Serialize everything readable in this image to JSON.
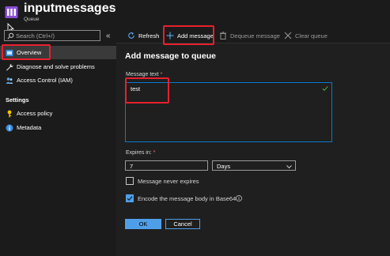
{
  "header": {
    "title": "inputmessages",
    "subtitle": "Queue",
    "more": "···"
  },
  "search": {
    "placeholder": "Search (Ctrl+/)",
    "value": ""
  },
  "collapse_glyph": "«",
  "sidebar": {
    "items": [
      {
        "label": "Overview",
        "icon": "overview-icon",
        "active": true
      },
      {
        "label": "Diagnose and solve problems",
        "icon": "wrench-icon"
      },
      {
        "label": "Access Control (IAM)",
        "icon": "people-icon"
      }
    ],
    "settings_label": "Settings",
    "settings_items": [
      {
        "label": "Access policy",
        "icon": "key-icon"
      },
      {
        "label": "Metadata",
        "icon": "info-icon"
      }
    ]
  },
  "toolbar": {
    "refresh": "Refresh",
    "add_message": "Add message",
    "dequeue_message": "Dequeue message",
    "clear_queue": "Clear queue"
  },
  "panel": {
    "title": "Add message to queue",
    "message_text_label": "Message text",
    "message_text_value": "test",
    "expires_label": "Expires in:",
    "expires_value": "7",
    "expires_unit": "Days",
    "never_expires_label": "Message never expires",
    "never_expires_checked": false,
    "encode_label": "Encode the message body in Base64",
    "encode_checked": true,
    "required_marker": "*",
    "ok_label": "OK",
    "cancel_label": "Cancel"
  },
  "colors": {
    "accent": "#4f9fe8",
    "focus_border": "#0b78d0",
    "highlight": "#e8202e",
    "background": "#1b1b1b"
  }
}
